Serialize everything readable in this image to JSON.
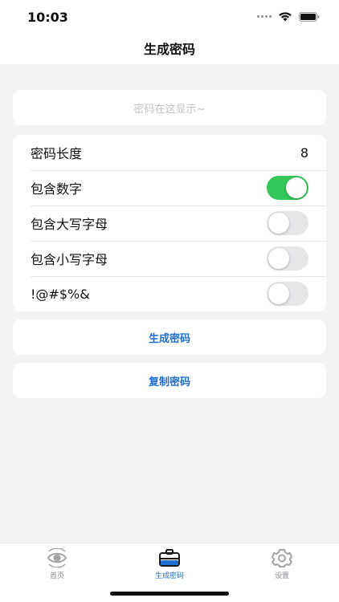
{
  "status_bar": {
    "time": "10:03"
  },
  "nav": {
    "title": "生成密码"
  },
  "display": {
    "placeholder": "密码在这显示~"
  },
  "settings": {
    "length": {
      "label": "密码长度",
      "value": "8"
    },
    "toggles": [
      {
        "label": "包含数字",
        "on": true
      },
      {
        "label": "包含大写字母",
        "on": false
      },
      {
        "label": "包含小写字母",
        "on": false
      },
      {
        "label": "!@#$%&",
        "on": false
      }
    ]
  },
  "buttons": {
    "generate": "生成密码",
    "copy": "复制密码"
  },
  "tabs": [
    {
      "label": "首页",
      "icon": "eye-icon",
      "selected": false
    },
    {
      "label": "生成密码",
      "icon": "briefcase-icon",
      "selected": true
    },
    {
      "label": "设置",
      "icon": "gear-icon",
      "selected": false
    }
  ],
  "colors": {
    "accent": "#1f6fd0",
    "toggle_on": "#34c759",
    "background": "#f3f3f3"
  }
}
